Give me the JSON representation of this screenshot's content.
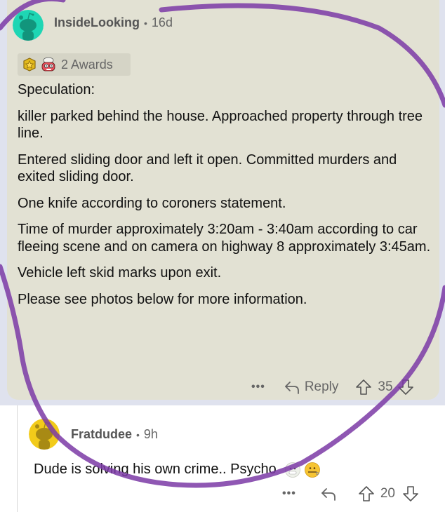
{
  "comment_main": {
    "username": "InsideLooking",
    "separator": "•",
    "age": "16d",
    "avatar_color": "#1ed6b4",
    "awards": {
      "icons": [
        "gold-star-award-icon",
        "mind-blown-award-icon"
      ],
      "label": "2 Awards"
    },
    "paragraphs": [
      "Speculation:",
      "killer parked behind the house. Approached property through tree line.",
      "Entered sliding door and left it open. Committed murders and exited sliding door.",
      "One knife according to coroners statement.",
      "Time of murder approximately 3:20am - 3:40am according to car fleeing scene and on camera on highway 8 approximately 3:45am.",
      "Vehicle left skid marks upon exit.",
      "Please see photos below for more information."
    ],
    "actions": {
      "more": "•••",
      "reply": "Reply",
      "score": "35"
    }
  },
  "comment_reply": {
    "username": "Fratdudee",
    "separator": "•",
    "age": "9h",
    "avatar_color": "#f2cb1a",
    "text": "Dude is solving his own crime.. Psycho",
    "emojis": [
      "cold-face-emoji",
      "zipper-mouth-face-emoji"
    ],
    "actions": {
      "more": "•••",
      "score": "20"
    }
  },
  "colors": {
    "annotation_stroke": "#7b3aa6",
    "card_background": "#e2e1d3",
    "outer_highlight": "#dfe2ee"
  }
}
